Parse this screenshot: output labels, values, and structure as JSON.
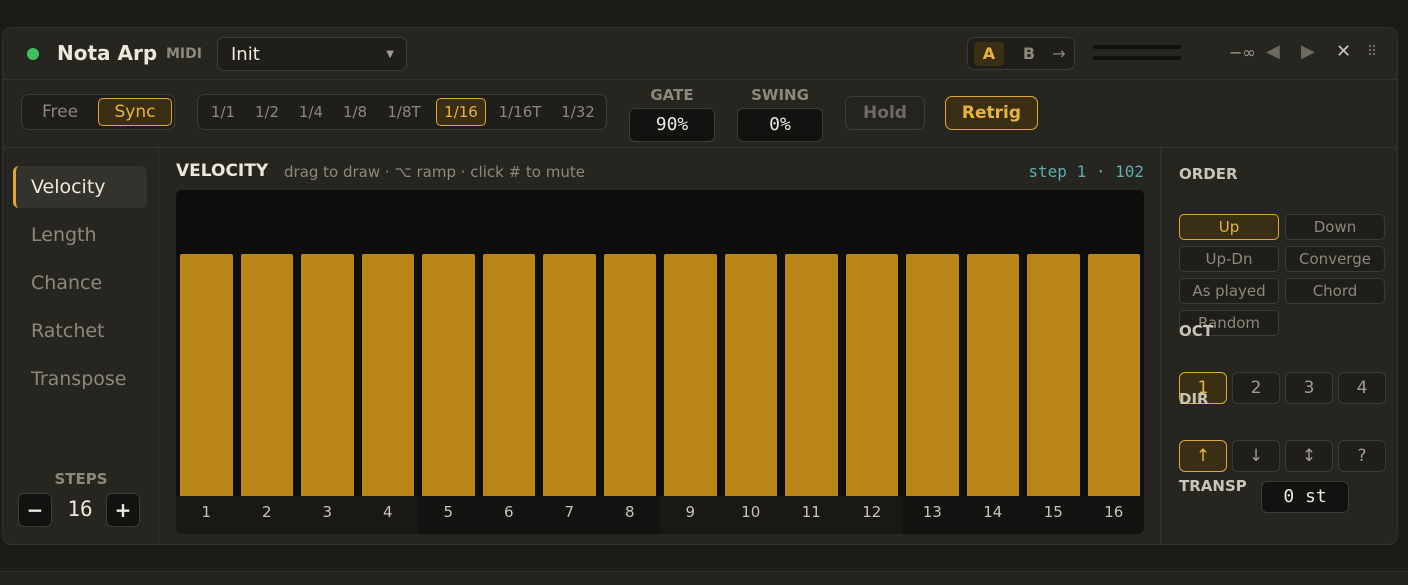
{
  "header": {
    "title": "Nota Arp",
    "badge": "MIDI",
    "preset": "Init",
    "ab": {
      "a": "A",
      "b": "B",
      "copy": "→"
    },
    "neg_inf": "−∞",
    "icons": [
      "prev-icon",
      "next-icon",
      "close-icon",
      "grip-icon"
    ],
    "power_color": "#3fbf5f"
  },
  "toolbar": {
    "mode": {
      "free": "Free",
      "sync": "Sync",
      "selected": "Sync"
    },
    "rates": [
      "1/1",
      "1/2",
      "1/4",
      "1/8",
      "1/8T",
      "1/16",
      "1/16T",
      "1/32"
    ],
    "rate_selected": "1/16",
    "gate": {
      "label": "GATE",
      "value": "90%"
    },
    "swing": {
      "label": "SWING",
      "value": "0%"
    },
    "hold": "Hold",
    "retrig": "Retrig"
  },
  "lanes": {
    "items": [
      "Velocity",
      "Length",
      "Chance",
      "Ratchet",
      "Transpose"
    ],
    "active": "Velocity",
    "steps_label": "STEPS",
    "steps_minus": "−",
    "steps_plus": "+",
    "steps_value": "16"
  },
  "editor": {
    "title": "VELOCITY",
    "hint": "drag to draw · ⌥ ramp · click # to mute",
    "readout": "step 1 · 102",
    "values": [
      102,
      102,
      102,
      102,
      102,
      102,
      102,
      102,
      102,
      102,
      102,
      102,
      102,
      102,
      102,
      102
    ],
    "max": 127,
    "step_labels": [
      "1",
      "2",
      "3",
      "4",
      "5",
      "6",
      "7",
      "8",
      "9",
      "10",
      "11",
      "12",
      "13",
      "14",
      "15",
      "16"
    ]
  },
  "right": {
    "order_label": "ORDER",
    "order": [
      "Up",
      "Down",
      "Up-Dn",
      "Converge",
      "As played",
      "Chord",
      "Random"
    ],
    "order_selected": "Up",
    "oct_label": "OCT",
    "oct": [
      "1",
      "2",
      "3",
      "4"
    ],
    "oct_selected": "1",
    "dir_label": "DIR",
    "dir": [
      "↑",
      "↓",
      "↕",
      "?"
    ],
    "dir_selected": "↑",
    "transp_label": "TRANSP",
    "transp_value": "0 st"
  },
  "colors": {
    "accent": "#e0a830",
    "bar": "#bb8618",
    "readout": "#5aaeb0"
  }
}
